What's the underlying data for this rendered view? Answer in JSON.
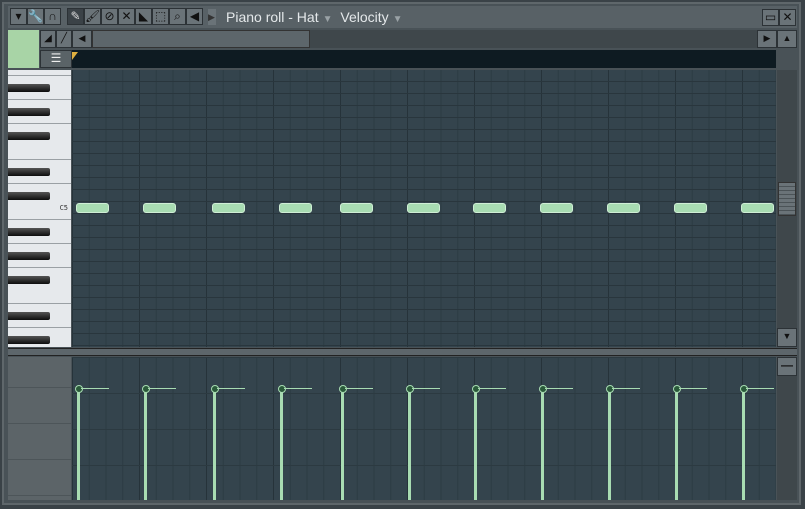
{
  "window": {
    "title": "Piano roll - Hat",
    "target": "Velocity"
  },
  "toolbar": {
    "icons": [
      "menu-arrow-icon",
      "wrench-icon",
      "magnet-icon",
      "pencil-icon",
      "paint-brush-icon",
      "delete-icon",
      "mute-icon",
      "slice-icon",
      "select-icon",
      "zoom-icon",
      "playback-icon"
    ]
  },
  "keyboard": {
    "c5_label": "C5"
  },
  "colors": {
    "note": "#a8dcb2",
    "grid": "#34444d",
    "accent_swatch": "#a8d4a6"
  },
  "notes": [
    {
      "pitch": "C5",
      "step": 1
    },
    {
      "pitch": "C5",
      "step": 2
    },
    {
      "pitch": "C5",
      "step": 3
    },
    {
      "pitch": "C5",
      "step": 4
    },
    {
      "pitch": "C5",
      "step": 5
    },
    {
      "pitch": "C5",
      "step": 6
    },
    {
      "pitch": "C5",
      "step": 7
    },
    {
      "pitch": "C5",
      "step": 8
    },
    {
      "pitch": "C5",
      "step": 9
    },
    {
      "pitch": "C5",
      "step": 10
    },
    {
      "pitch": "C5",
      "step": 11
    }
  ],
  "velocity_level": 0.78
}
